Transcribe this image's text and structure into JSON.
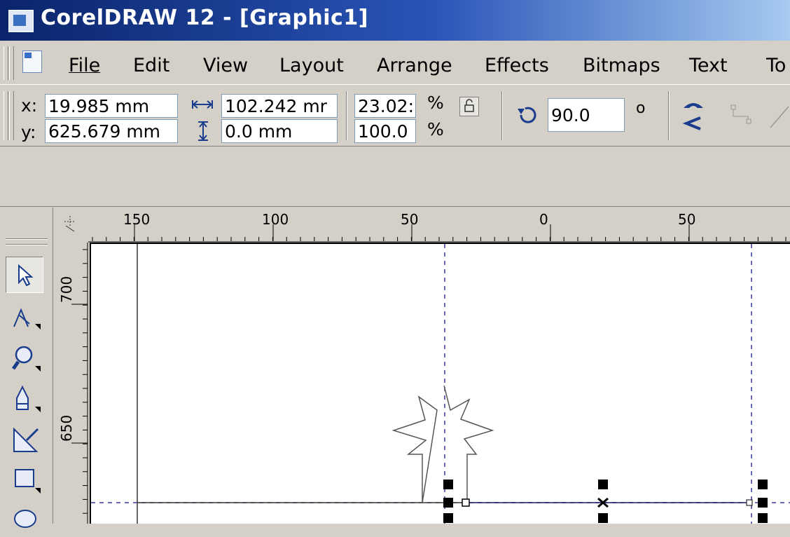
{
  "window": {
    "title": "CorelDRAW 12 - [Graphic1]"
  },
  "menu": {
    "items": [
      {
        "label": "File",
        "mnemonic": "F"
      },
      {
        "label": "Edit",
        "mnemonic": "E"
      },
      {
        "label": "View",
        "mnemonic": "V"
      },
      {
        "label": "Layout",
        "mnemonic": "L"
      },
      {
        "label": "Arrange",
        "mnemonic": "A"
      },
      {
        "label": "Effects",
        "mnemonic": "c"
      },
      {
        "label": "Bitmaps",
        "mnemonic": "B"
      },
      {
        "label": "Text",
        "mnemonic": "T"
      },
      {
        "label": "To",
        "mnemonic": "o"
      }
    ]
  },
  "property_bar": {
    "x_label": "x:",
    "y_label": "y:",
    "x_value": "19.985 mm",
    "y_value": "625.679 mm",
    "width_value": "102.242 mr",
    "height_value": "0.0 mm",
    "scale_x_value": "23.02:",
    "scale_y_value": "100.0",
    "percent_symbol": "%",
    "rotation_value": "90.0",
    "degree_symbol": "o"
  },
  "rulers": {
    "horizontal_labels": [
      "150",
      "100",
      "50",
      "0",
      "50"
    ],
    "vertical_labels": [
      "700",
      "650"
    ]
  },
  "icons": {
    "app": "coreldraw-app-icon",
    "document": "document-icon",
    "width": "width-arrows-icon",
    "height": "height-arrows-icon",
    "lock": "lock-ratio-icon",
    "rotate": "rotate-icon",
    "mirror": "mirror-icon",
    "tools": [
      "pick-tool-icon",
      "shape-tool-icon",
      "zoom-tool-icon",
      "freehand-tool-icon",
      "smart-fill-tool-icon",
      "rectangle-tool-icon",
      "ellipse-tool-icon"
    ]
  },
  "colors": {
    "titlebar_start": "#0a246a",
    "titlebar_end": "#a6caf0",
    "guideline": "#3a3a9a",
    "chrome": "#d4d0c8"
  }
}
